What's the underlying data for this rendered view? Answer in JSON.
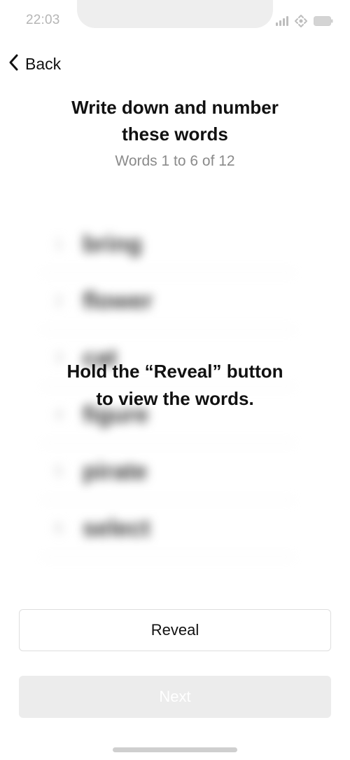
{
  "status_bar": {
    "time": "22:03",
    "icons": [
      "signal-icon",
      "wifi-icon",
      "battery-icon"
    ]
  },
  "header": {
    "back_label": "Back",
    "title_line1": "Write down and number",
    "title_line2": "these words",
    "subtitle": "Words 1 to 6 of 12"
  },
  "word_list": {
    "blurred": true,
    "rows": [
      {
        "index": "1",
        "word": "bring"
      },
      {
        "index": "2",
        "word": "flower"
      },
      {
        "index": "3",
        "word": "cat"
      },
      {
        "index": "4",
        "word": "figure"
      },
      {
        "index": "5",
        "word": "pirate"
      },
      {
        "index": "6",
        "word": "select"
      }
    ]
  },
  "overlay": {
    "hint_line1": "Hold the “Reveal” button",
    "hint_line2": "to view the words."
  },
  "actions": {
    "reveal_label": "Reveal",
    "next_label": "Next",
    "next_enabled": false
  },
  "colors": {
    "text_primary": "#111111",
    "text_secondary": "#8a8a8a",
    "button_disabled_bg": "#ececec",
    "border": "#dedede"
  }
}
